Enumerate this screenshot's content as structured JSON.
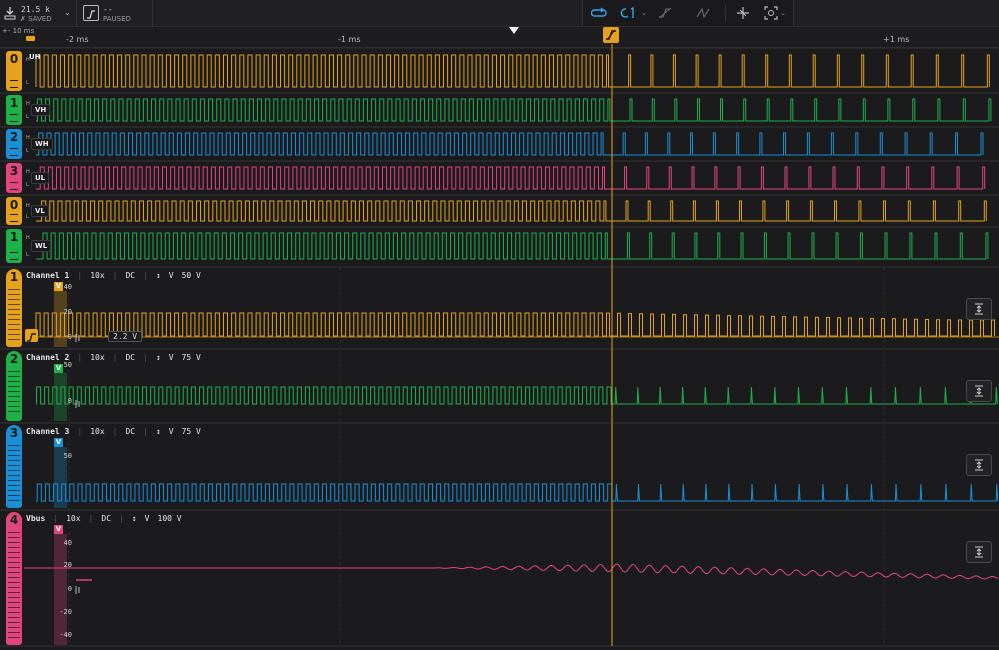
{
  "toolbar": {
    "sample_rate": "21.5 k",
    "saved_status": "SAVED",
    "trigger_value": "--",
    "run_status": "PAUSED"
  },
  "ruler": {
    "zoom_label": "+- 10 ms",
    "time_labels": [
      "-2 ms",
      "-1 ms",
      "+1 ms"
    ]
  },
  "digital_channels": [
    {
      "id": "0",
      "name": "UH",
      "color": "#e6a21c"
    },
    {
      "id": "1",
      "name": "VH",
      "color": "#1eb14a"
    },
    {
      "id": "2",
      "name": "WH",
      "color": "#1a8fd6"
    },
    {
      "id": "3",
      "name": "UL",
      "color": "#e0457c"
    },
    {
      "id": "0",
      "name": "VL",
      "color": "#e6a21c"
    },
    {
      "id": "1",
      "name": "WL",
      "color": "#1eb14a"
    }
  ],
  "analog_channels": [
    {
      "id": "1",
      "name": "Channel 1",
      "probe": "10x",
      "coupling": "DC",
      "unit": "V",
      "range": "50 V",
      "color": "#e6a21c",
      "ticks": [
        "40",
        "20",
        "0"
      ],
      "trigger_level": "2.2 V"
    },
    {
      "id": "2",
      "name": "Channel 2",
      "probe": "10x",
      "coupling": "DC",
      "unit": "V",
      "range": "75 V",
      "color": "#1eb14a",
      "ticks": [
        "50",
        "0"
      ]
    },
    {
      "id": "3",
      "name": "Channel 3",
      "probe": "10x",
      "coupling": "DC",
      "unit": "V",
      "range": "75 V",
      "color": "#1a8fd6",
      "ticks": [
        "50"
      ]
    },
    {
      "id": "4",
      "name": "Vbus",
      "probe": "10x",
      "coupling": "DC",
      "unit": "V",
      "range": "100 V",
      "color": "#e0457c",
      "ticks": [
        "40",
        "20",
        "0",
        "-20",
        "-40"
      ]
    }
  ],
  "level_markers": {
    "high": "H",
    "low": "L",
    "volts": "V"
  }
}
